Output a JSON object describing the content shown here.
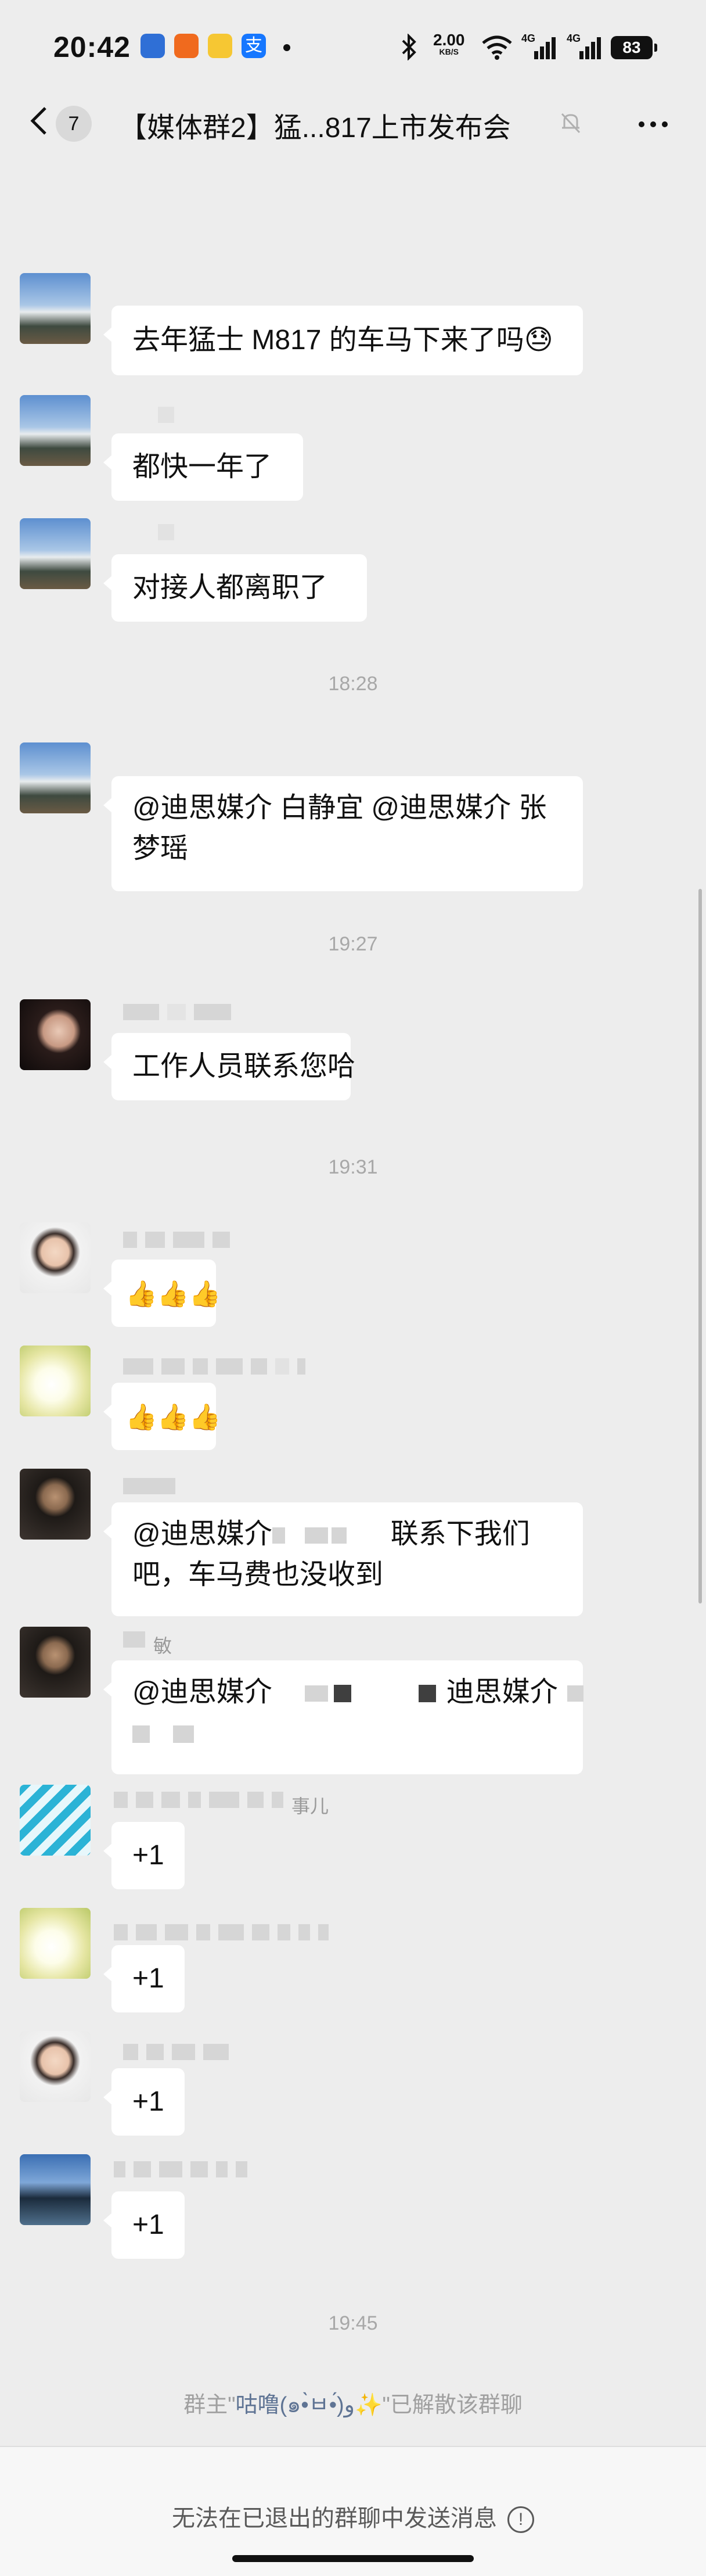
{
  "status": {
    "time": "20:42",
    "net_speed": "2.00",
    "net_unit": "KB/S",
    "sig1_label": "4G",
    "sig2_label": "4G",
    "battery": "83"
  },
  "nav": {
    "unread_count": "7",
    "title": "【媒体群2】猛...817上市发布会"
  },
  "messages": [
    {
      "text": "去年猛士 M817 的车马下来了吗😓"
    },
    {
      "text": "都快一年了"
    },
    {
      "text": "对接人都离职了"
    },
    {
      "time": "18:28"
    },
    {
      "line1": "@迪思媒介 白静宜  @迪思媒介 张",
      "line2": "梦瑶"
    },
    {
      "time": "19:27"
    },
    {
      "text": "工作人员联系您哈"
    },
    {
      "time": "19:31"
    },
    {
      "text": "👍👍👍"
    },
    {
      "text": "👍👍👍"
    },
    {
      "line1_a": "@迪思媒介",
      "line1_b": "联系下我们",
      "line2": "吧，车马费也没收到"
    },
    {
      "nick_tail": "敏",
      "line1_a": "@迪思媒介",
      "line1_b": "迪思媒介"
    },
    {
      "nick_tail": "事儿",
      "text": "+1"
    },
    {
      "text": "+1"
    },
    {
      "text": "+1"
    },
    {
      "text": "+1"
    }
  ],
  "footer_time": "19:45",
  "system": {
    "prefix": "群主\"",
    "owner": "咕噜(๑•̀ㅂ•́)و✨",
    "suffix": "\"已解散该群聊"
  },
  "footer": {
    "notice": "无法在已退出的群聊中发送消息",
    "icon": "info-icon"
  }
}
